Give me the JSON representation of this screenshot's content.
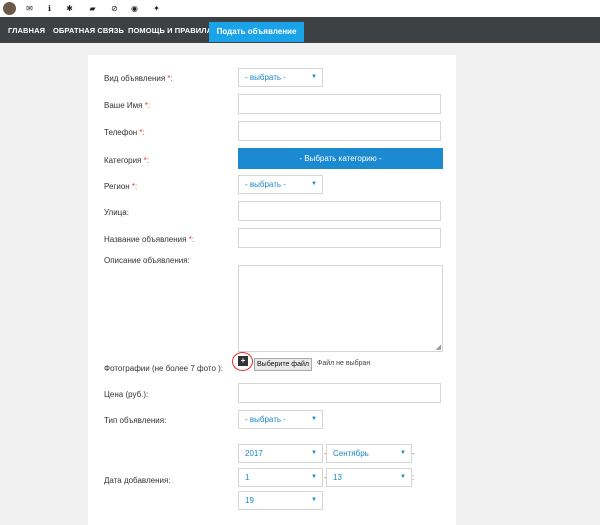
{
  "topbar": {
    "icons": [
      "avatar",
      "mail-icon",
      "info-icon",
      "settings-icon",
      "folder-icon",
      "block-icon",
      "eye-icon",
      "puzzle-icon"
    ]
  },
  "nav": {
    "items": [
      "ГЛАВНАЯ",
      "ОБРАТНАЯ СВЯЗЬ",
      "ПОМОЩЬ И ПРАВИЛА"
    ],
    "cta": "Подать объявление"
  },
  "form": {
    "ad_type": {
      "label": "Вид объявления",
      "req": " *:",
      "value": "- выбрать -"
    },
    "name": {
      "label": "Ваше Имя",
      "req": " *:"
    },
    "phone": {
      "label": "Телефон",
      "req": " *:"
    },
    "category": {
      "label": "Категория",
      "req": " *:",
      "button": "- Выбрать категорию -"
    },
    "region": {
      "label": "Регион",
      "req": " *:",
      "value": "- выбрать -"
    },
    "street": {
      "label": "Улица:"
    },
    "title": {
      "label": "Название объявления",
      "req": " *:"
    },
    "description": {
      "label": "Описание объявления:"
    },
    "photos": {
      "label": "Фотографии (не более 7 фото ):",
      "plus": "+",
      "choose": "Выберите файл",
      "status": "Файл не выбран"
    },
    "price": {
      "label": "Цена (руб.):"
    },
    "listing_type": {
      "label": "Тип объявления:",
      "value": "- выбрать -"
    },
    "date": {
      "label": "Дата добавления:",
      "year": "2017",
      "month": "Сентябрь",
      "day": "1",
      "hour": "13",
      "minute": "19"
    }
  },
  "colors": {
    "navbar": "#3d4144",
    "accent": "#1aa3e8",
    "required": "#e03a3a",
    "select_text": "#1a86c9"
  }
}
